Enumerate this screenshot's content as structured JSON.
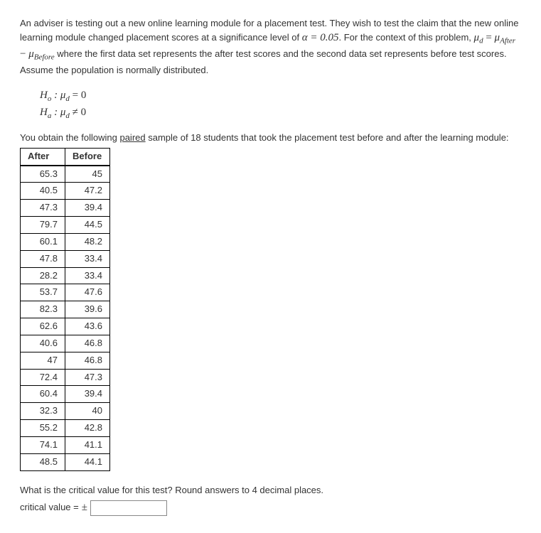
{
  "intro": {
    "p1_a": "An adviser is testing out a new online learning module for a placement test. They wish to test the claim that the new online learning module changed placement scores at a significance level of ",
    "alpha_expr": "α = 0.05",
    "p1_b": ". For the context of this problem, ",
    "mu_d": "μ",
    "mu_d_sub": "d",
    "eq": " = ",
    "mu_after": "μ",
    "mu_after_sub": "After",
    "minus": " − ",
    "mu_before": "μ",
    "mu_before_sub": "Before",
    "p1_c": " where the first data set represents the after test scores and the second data set represents before test scores. Assume the population is normally distributed."
  },
  "hyp": {
    "h0_label": "H",
    "h0_sub": "o",
    "h0_body": " : μ",
    "h0_mu_sub": "d",
    "h0_rhs": " = 0",
    "ha_label": "H",
    "ha_sub": "a",
    "ha_body": " : μ",
    "ha_mu_sub": "d",
    "ha_rhs": " ≠ 0"
  },
  "sample_text_a": "You obtain the following ",
  "sample_text_paired": "paired",
  "sample_text_b": " sample of 18 students that took the placement test before and after the learning module:",
  "table": {
    "headers": {
      "after": "After",
      "before": "Before"
    },
    "rows": [
      {
        "after": "65.3",
        "before": "45"
      },
      {
        "after": "40.5",
        "before": "47.2"
      },
      {
        "after": "47.3",
        "before": "39.4"
      },
      {
        "after": "79.7",
        "before": "44.5"
      },
      {
        "after": "60.1",
        "before": "48.2"
      },
      {
        "after": "47.8",
        "before": "33.4"
      },
      {
        "after": "28.2",
        "before": "33.4"
      },
      {
        "after": "53.7",
        "before": "47.6"
      },
      {
        "after": "82.3",
        "before": "39.6"
      },
      {
        "after": "62.6",
        "before": "43.6"
      },
      {
        "after": "40.6",
        "before": "46.8"
      },
      {
        "after": "47",
        "before": "46.8"
      },
      {
        "after": "72.4",
        "before": "47.3"
      },
      {
        "after": "60.4",
        "before": "39.4"
      },
      {
        "after": "32.3",
        "before": "40"
      },
      {
        "after": "55.2",
        "before": "42.8"
      },
      {
        "after": "74.1",
        "before": "41.1"
      },
      {
        "after": "48.5",
        "before": "44.1"
      }
    ]
  },
  "question": "What is the critical value for this test? Round answers to 4 decimal places.",
  "answer_label": "critical value = ",
  "pm": "±",
  "answer_value": ""
}
